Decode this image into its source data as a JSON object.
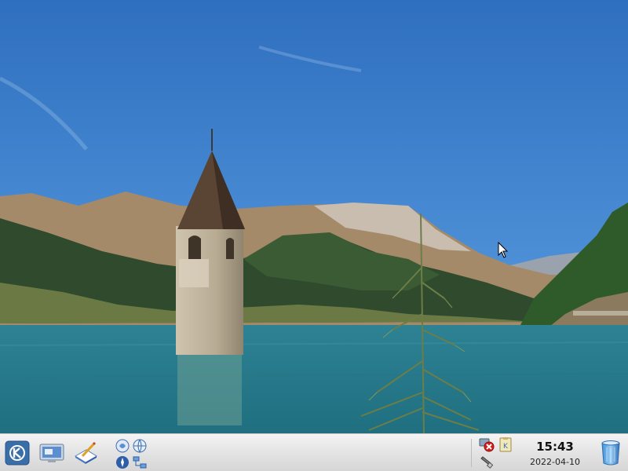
{
  "desktop": {
    "wallpaper": "lake-with-submerged-bell-tower-and-mountains",
    "colors": {
      "sky": "#3f7fc9",
      "lake": "#2a7d8c",
      "taskbar": "#e6e6e6",
      "kmenu": "#3a6ea8"
    }
  },
  "taskbar": {
    "launchers": [
      {
        "icon": "k-menu-icon"
      },
      {
        "icon": "show-desktop-icon"
      },
      {
        "icon": "text-editor-icon"
      },
      {
        "icon": "konqueror-icon"
      },
      {
        "icon": "web-browser-icon"
      },
      {
        "icon": "compass-icon"
      },
      {
        "icon": "network-icon"
      }
    ],
    "tray": [
      {
        "icon": "network-disconnected-icon"
      },
      {
        "icon": "klipper-icon"
      },
      {
        "icon": "usb-device-icon"
      }
    ],
    "clock": {
      "time": "15:43",
      "date": "2022-04-10"
    },
    "trash": {
      "icon": "trash-icon"
    }
  }
}
